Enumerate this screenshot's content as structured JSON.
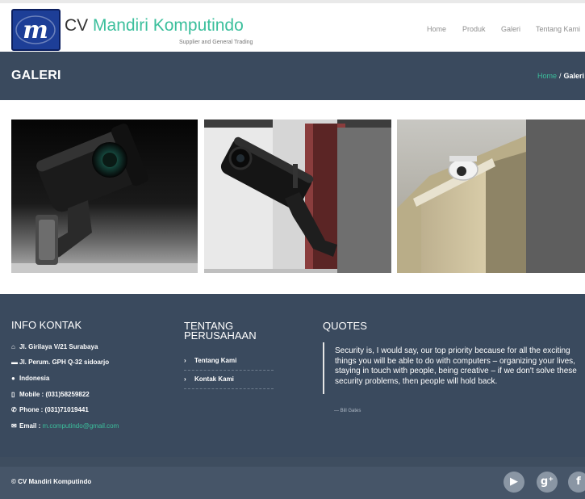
{
  "header": {
    "brand_prefix": "CV ",
    "brand_name": "Mandiri Komputindo",
    "tagline": "Supplier and General Trading",
    "logo_letter": "m",
    "nav": [
      "Home",
      "Produk",
      "Galeri",
      "Tentang Kami"
    ]
  },
  "page_title": "GALERI",
  "breadcrumb": {
    "home": "Home",
    "separator": "/",
    "current": "Galeri"
  },
  "gallery": [
    {
      "name": "security-camera-bullet-dark",
      "alt": ""
    },
    {
      "name": "security-camera-bullet-wall",
      "alt": ""
    },
    {
      "name": "security-camera-dome-ceiling",
      "alt": ""
    }
  ],
  "footer": {
    "info": {
      "title": "INFO KONTAK",
      "address1": "Jl. Girilaya V/21 Surabaya",
      "address2": "Jl. Perum. GPH Q-32 sidoarjo",
      "country": "Indonesia",
      "mobile": "Mobile : (031)58259822",
      "phone": "Phone : (031)71019441",
      "email_label": "Email : ",
      "email": "m.computindo@gmail.com"
    },
    "about": {
      "title_line1": "TENTANG",
      "title_line2": "PERUSAHAAN",
      "links": [
        "Tentang Kami",
        "Kontak Kami"
      ]
    },
    "quotes": {
      "title": "QUOTES",
      "text": "Security is, I would say, our top priority because for all the exciting things you will be able to do with computers – organizing your lives, staying in touch with people, being creative – if we don't solve these security problems, then people will hold back.",
      "author": "— Bill Gates"
    },
    "copyright": "© CV Mandiri Komputindo",
    "social": [
      {
        "icon": "youtube-icon",
        "glyph": "▶"
      },
      {
        "icon": "google-plus-icon",
        "glyph": "g⁺"
      },
      {
        "icon": "facebook-icon",
        "glyph": "f"
      }
    ]
  },
  "colors": {
    "accent": "#3bbf9c",
    "dark_panel": "#3a4a5e",
    "logo_blue": "#1d3e97"
  }
}
